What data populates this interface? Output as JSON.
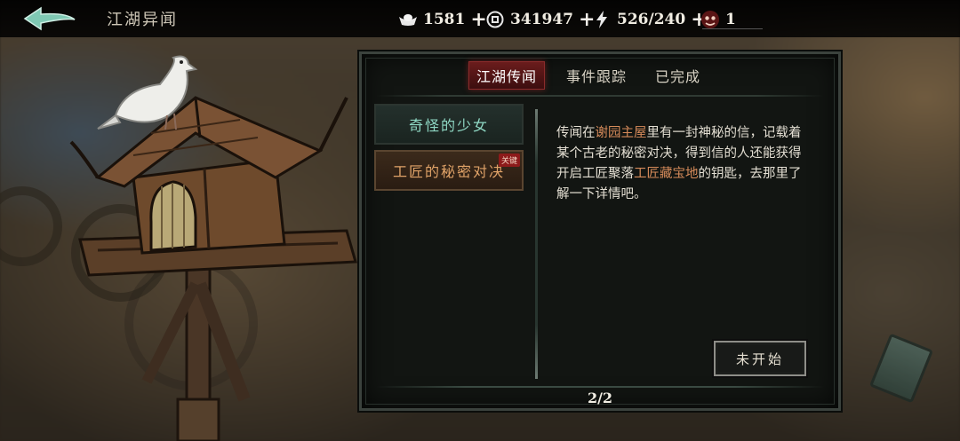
{
  "header": {
    "title": "江湖异闻"
  },
  "resources": [
    {
      "icon": "silver-ingot-icon",
      "value": "1581"
    },
    {
      "icon": "copper-coin-icon",
      "value": "341947"
    },
    {
      "icon": "lightning-stamina-icon",
      "value": "526/240"
    },
    {
      "icon": "demon-mask-icon",
      "value": "1"
    }
  ],
  "tabs": [
    {
      "label": "江湖传闻",
      "active": true
    },
    {
      "label": "事件跟踪",
      "active": false
    },
    {
      "label": "已完成",
      "active": false
    }
  ],
  "quests": [
    {
      "name": "奇怪的少女"
    },
    {
      "name": "工匠的秘密对决",
      "tag": "关键"
    }
  ],
  "description": {
    "p1": "传闻在",
    "hl1": "谢园主屋",
    "p2": "里有一封神秘的信，记载着某个古老的秘密对决，得到信的人还能获得开启工匠聚落",
    "hl2": "工匠藏宝地",
    "p3": "的钥匙，去那里了解一下详情吧。"
  },
  "status_button": "未开始",
  "pager": "2/2",
  "colors": {
    "accent_red": "#8b2b2b",
    "highlight_orange": "#d68b5a",
    "quest_teal": "#8fd8c4",
    "quest_orange": "#e0a368"
  }
}
